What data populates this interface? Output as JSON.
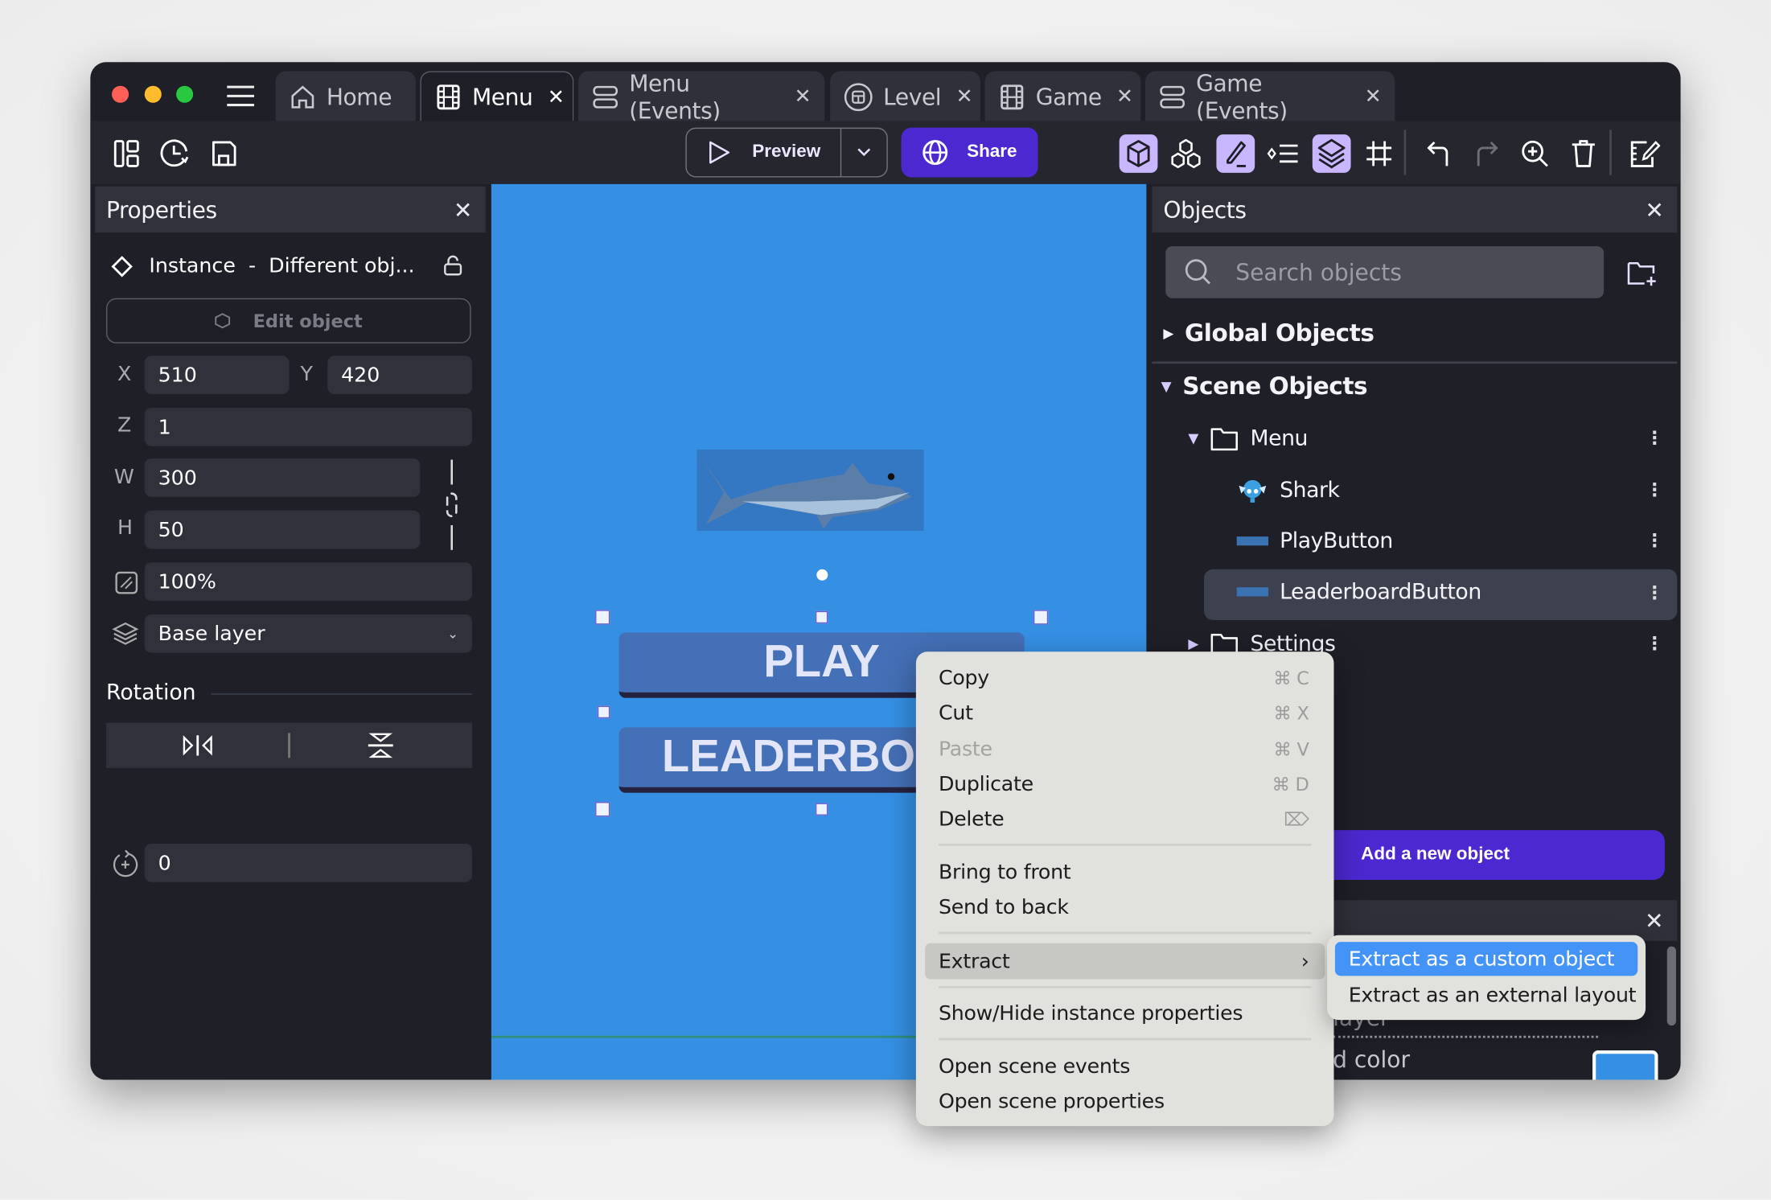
{
  "tabs": [
    {
      "label": "Home",
      "icon": "home-icon",
      "closable": false
    },
    {
      "label": "Menu",
      "icon": "film-icon",
      "closable": true,
      "active": true
    },
    {
      "label": "Menu (Events)",
      "icon": "events-icon",
      "closable": true
    },
    {
      "label": "Level",
      "icon": "level-icon",
      "closable": true
    },
    {
      "label": "Game",
      "icon": "film-icon",
      "closable": true
    },
    {
      "label": "Game (Events)",
      "icon": "events-icon",
      "closable": true
    }
  ],
  "toolbar": {
    "preview_label": "Preview",
    "share_label": "Share",
    "accent": "#4c28d0",
    "toggle_on_color": "#c8b6ff"
  },
  "properties": {
    "title": "Properties",
    "instance_label": "Instance  -  Different obj...",
    "edit_object_label": "Edit object",
    "x_label": "X",
    "x": "510",
    "y_label": "Y",
    "y": "420",
    "z_label": "Z",
    "z": "1",
    "w_label": "W",
    "w": "300",
    "h_label": "H",
    "h": "50",
    "opacity": "100%",
    "layer": "Base layer",
    "rotation_title": "Rotation",
    "rotation": "0"
  },
  "canvas": {
    "background": "#3590e4",
    "play_text": "PLAY",
    "leaderboard_text": "LEADERBOA"
  },
  "objects": {
    "title": "Objects",
    "search_placeholder": "Search objects",
    "global_objects": "Global Objects",
    "scene_objects": "Scene Objects",
    "items": [
      {
        "label": "Menu",
        "type": "folder"
      },
      {
        "label": "Shark",
        "type": "sprite"
      },
      {
        "label": "PlayButton",
        "type": "panel"
      },
      {
        "label": "LeaderboardButton",
        "type": "panel",
        "selected": true
      },
      {
        "label": "Settings",
        "type": "folder"
      }
    ],
    "add_label": "Add a new object",
    "layer_partial": "layer",
    "color_partial": "d color",
    "color_swatch": "#3590e4"
  },
  "context_menu": {
    "items": [
      {
        "label": "Copy",
        "shortcut": "⌘ C"
      },
      {
        "label": "Cut",
        "shortcut": "⌘ X"
      },
      {
        "label": "Paste",
        "shortcut": "⌘ V",
        "disabled": true
      },
      {
        "label": "Duplicate",
        "shortcut": "⌘ D"
      },
      {
        "label": "Delete",
        "shortcut": "⌦"
      },
      {
        "label": "Bring to front"
      },
      {
        "label": "Send to back"
      },
      {
        "label": "Extract"
      },
      {
        "label": "Show/Hide instance properties"
      },
      {
        "label": "Open scene events"
      },
      {
        "label": "Open scene properties"
      }
    ],
    "submenu": [
      {
        "label": "Extract as a custom object",
        "highlighted": true
      },
      {
        "label": "Extract as an external layout"
      }
    ],
    "highlight_color": "#4494f8"
  }
}
